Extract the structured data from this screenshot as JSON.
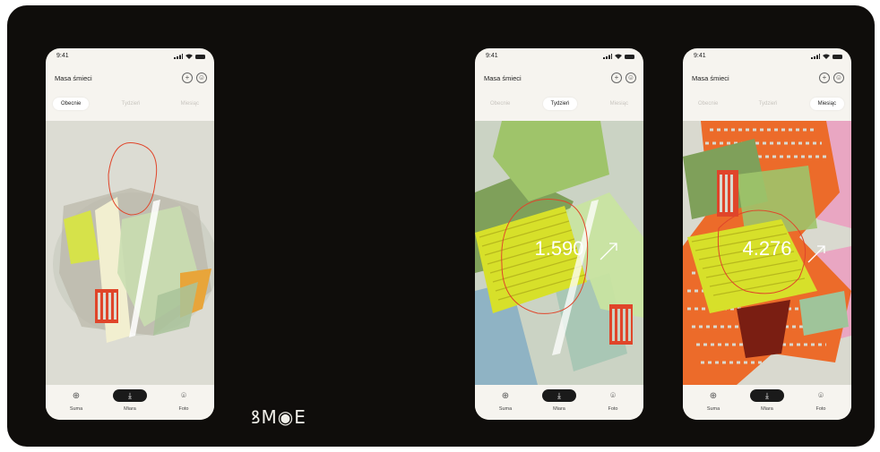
{
  "brand": {
    "logo_text": "ꝸM◉E"
  },
  "phones": [
    {
      "status_time": "9:41",
      "title": "Masa śmieci",
      "tabs": [
        "Obecnie",
        "Tydzień",
        "Miesiąc"
      ],
      "active_tab": 0,
      "big_value": "",
      "nav": [
        {
          "label": "Suma",
          "icon": "crosshair-icon"
        },
        {
          "label": "Miara",
          "icon": "download-icon"
        },
        {
          "label": "Foto",
          "icon": "scan-icon"
        }
      ]
    },
    {
      "status_time": "9:41",
      "title": "Masa śmieci",
      "tabs": [
        "Obecnie",
        "Tydzień",
        "Miesiąc"
      ],
      "active_tab": 1,
      "big_value": "1.590",
      "nav": [
        {
          "label": "Suma",
          "icon": "crosshair-icon"
        },
        {
          "label": "Miara",
          "icon": "download-icon"
        },
        {
          "label": "Foto",
          "icon": "scan-icon"
        }
      ]
    },
    {
      "status_time": "9:41",
      "title": "Masa śmieci",
      "tabs": [
        "Obecnie",
        "Tydzień",
        "Miesiąc"
      ],
      "active_tab": 2,
      "big_value": "4.276",
      "nav": [
        {
          "label": "Suma",
          "icon": "crosshair-icon"
        },
        {
          "label": "Miara",
          "icon": "download-icon"
        },
        {
          "label": "Foto",
          "icon": "scan-icon"
        }
      ]
    }
  ],
  "colors": {
    "board": "#0f0d0b",
    "phone_bg": "#f6f4ef",
    "art_bg": "#dadad2",
    "accent_red": "#e0452a",
    "accent_lime": "#d7e85a",
    "accent_green": "#8fb86a",
    "accent_pink": "#e9a6c2",
    "accent_orange": "#ec6b2a"
  }
}
